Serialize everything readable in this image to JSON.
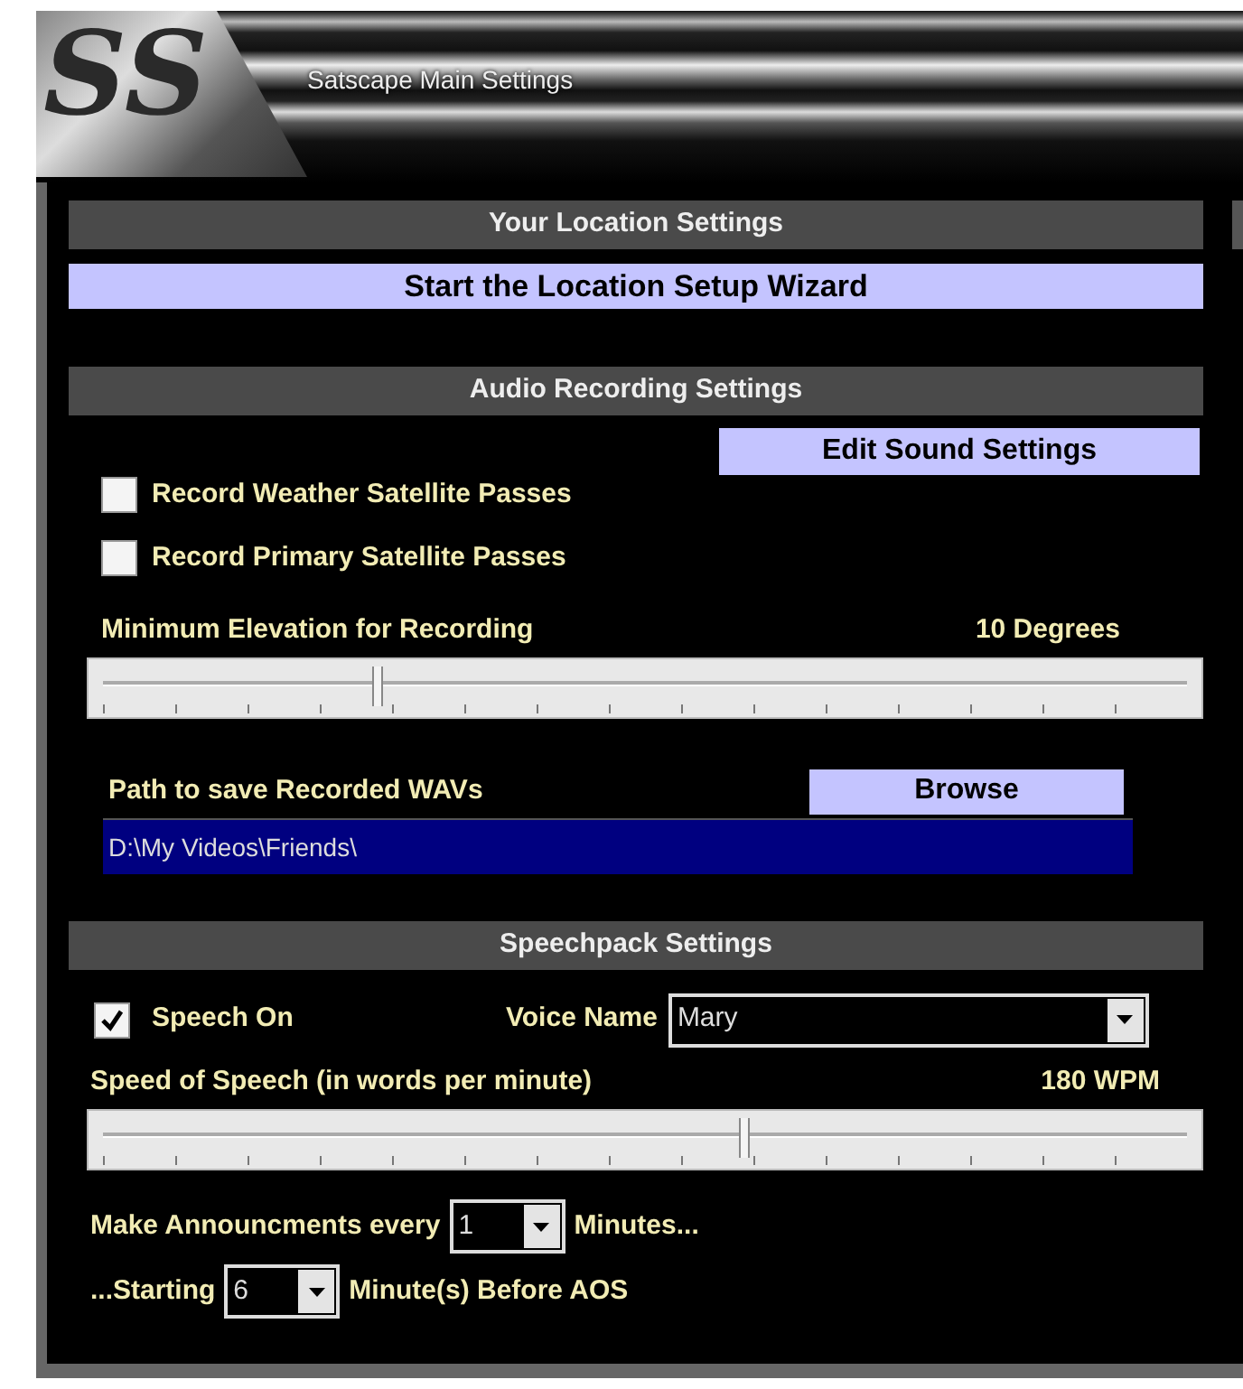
{
  "window": {
    "logo": "SS",
    "title": "Satscape Main Settings"
  },
  "location": {
    "heading": "Your Location Settings",
    "wizard_button": "Start the Location Setup Wizard"
  },
  "audio": {
    "heading": "Audio Recording Settings",
    "edit_button": "Edit Sound Settings",
    "checkboxes": [
      {
        "label": "Record Weather Satellite Passes",
        "checked": false
      },
      {
        "label": "Record Primary Satellite Passes",
        "checked": false
      }
    ],
    "elevation": {
      "label": "Minimum Elevation for Recording",
      "reading": "10 Degrees",
      "level": 0.26
    },
    "path": {
      "label": "Path to save Recorded WAVs",
      "browse_button": "Browse",
      "value": "D:\\My Videos\\Friends\\"
    }
  },
  "speech": {
    "heading": "Speechpack Settings",
    "speech_on": {
      "label": "Speech On",
      "checked": true
    },
    "voice": {
      "label": "Voice Name",
      "value": "Mary"
    },
    "speed": {
      "label": "Speed of Speech (in words per minute)",
      "reading": "180 WPM",
      "level": 0.59
    },
    "announce": {
      "prefix": "Make Announcments every",
      "value": "1",
      "suffix": "Minutes..."
    },
    "starting": {
      "prefix": "...Starting",
      "value": "6",
      "suffix": "Minute(s) Before AOS"
    }
  }
}
